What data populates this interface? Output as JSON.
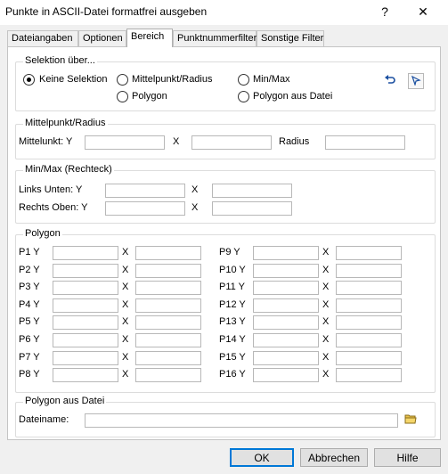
{
  "window": {
    "title": "Punkte in ASCII-Datei formatfrei ausgeben",
    "help_glyph": "?",
    "close_glyph": "✕"
  },
  "tabs": [
    {
      "label": "Dateiangaben"
    },
    {
      "label": "Optionen"
    },
    {
      "label": "Bereich",
      "active": true
    },
    {
      "label": "Punktnummerfilter"
    },
    {
      "label": "Sonstige Filter"
    }
  ],
  "selektion": {
    "legend": "Selektion über...",
    "options": {
      "keine": "Keine Selektion",
      "mittelpunkt": "Mittelpunkt/Radius",
      "minmax": "Min/Max",
      "polygon": "Polygon",
      "polygon_datei": "Polygon aus Datei"
    },
    "selected": "keine",
    "icons": [
      "undo-icon",
      "select-cursor-icon"
    ]
  },
  "mittelpunkt": {
    "legend": "Mittelpunkt/Radius",
    "y_label": "Mittelunkt: Y",
    "x_label": "X",
    "radius_label": "Radius",
    "y_value": "",
    "x_value": "",
    "radius_value": ""
  },
  "minmax": {
    "legend": "Min/Max (Rechteck)",
    "links_label": "Links Unten: Y",
    "rechts_label": "Rechts Oben: Y",
    "x_label": "X"
  },
  "polygon": {
    "legend": "Polygon",
    "points": [
      {
        "label": "P1  Y",
        "x": "X"
      },
      {
        "label": "P2  Y",
        "x": "X"
      },
      {
        "label": "P3  Y",
        "x": "X"
      },
      {
        "label": "P4  Y",
        "x": "X"
      },
      {
        "label": "P5  Y",
        "x": "X"
      },
      {
        "label": "P6  Y",
        "x": "X"
      },
      {
        "label": "P7  Y",
        "x": "X"
      },
      {
        "label": "P8  Y",
        "x": "X"
      },
      {
        "label": "P9  Y",
        "x": "X"
      },
      {
        "label": "P10 Y",
        "x": "X"
      },
      {
        "label": "P11 Y",
        "x": "X"
      },
      {
        "label": "P12 Y",
        "x": "X"
      },
      {
        "label": "P13 Y",
        "x": "X"
      },
      {
        "label": "P14 Y",
        "x": "X"
      },
      {
        "label": "P15 Y",
        "x": "X"
      },
      {
        "label": "P16 Y",
        "x": "X"
      }
    ]
  },
  "polygon_datei": {
    "legend": "Polygon aus Datei",
    "dateiname_label": "Dateiname:",
    "dateiname_value": "",
    "browse_icon": "folder-icon"
  },
  "buttons": {
    "ok": "OK",
    "abbrechen": "Abbrechen",
    "hilfe": "Hilfe"
  }
}
